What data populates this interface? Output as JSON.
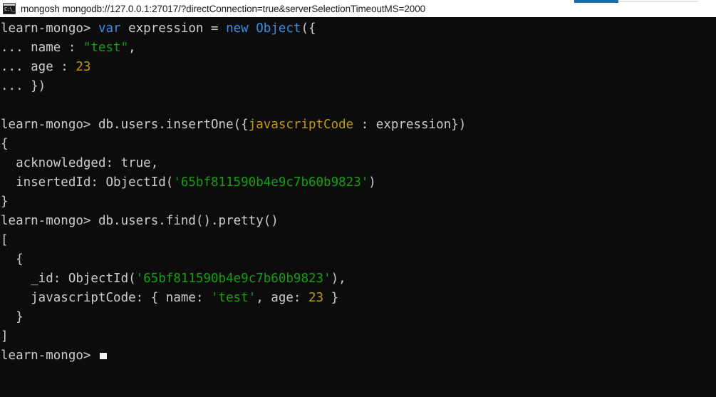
{
  "window": {
    "title": "mongosh mongodb://127.0.0.1:27017/?directConnection=true&serverSelectionTimeoutMS=2000",
    "icon": "console-cmd-icon",
    "icon_glyph": "C:\\_",
    "accent_color": "#1a6fa8",
    "titlebar_bg": "#ffffff",
    "titlebar_text_color": "#1b1b1b"
  },
  "terminal": {
    "background": "#0c0c0c",
    "foreground": "#cccccc",
    "prompt": "learn-mongo>",
    "continuation_prompt": "...",
    "colors": {
      "keyword": "#3b8eea",
      "string": "#13a10e",
      "number": "#c19c00",
      "boolean": "#c19c00",
      "field": "#c19c00",
      "default": "#cccccc"
    },
    "cursor": {
      "shape": "underscore-block",
      "color": "#f2f2f2"
    },
    "lines": [
      {
        "id": "line-1",
        "tokens": [
          {
            "t": "learn-mongo> ",
            "c": "default"
          },
          {
            "t": "var",
            "c": "keyword"
          },
          {
            "t": " expression = ",
            "c": "default"
          },
          {
            "t": "new",
            "c": "keyword"
          },
          {
            "t": " ",
            "c": "default"
          },
          {
            "t": "Object",
            "c": "keyword"
          },
          {
            "t": "({",
            "c": "default"
          }
        ]
      },
      {
        "id": "line-2",
        "tokens": [
          {
            "t": "... name : ",
            "c": "default"
          },
          {
            "t": "\"test\"",
            "c": "string"
          },
          {
            "t": ",",
            "c": "default"
          }
        ]
      },
      {
        "id": "line-3",
        "tokens": [
          {
            "t": "... age : ",
            "c": "default"
          },
          {
            "t": "23",
            "c": "number"
          }
        ]
      },
      {
        "id": "line-4",
        "tokens": [
          {
            "t": "... })",
            "c": "default"
          }
        ]
      },
      {
        "id": "line-5",
        "tokens": [
          {
            "t": "",
            "c": "default"
          }
        ]
      },
      {
        "id": "line-6",
        "tokens": [
          {
            "t": "learn-mongo> db.users.insertOne({",
            "c": "default"
          },
          {
            "t": "javascriptCode",
            "c": "field"
          },
          {
            "t": " : expression})",
            "c": "default"
          }
        ]
      },
      {
        "id": "line-7",
        "tokens": [
          {
            "t": "{",
            "c": "default"
          }
        ]
      },
      {
        "id": "line-8",
        "tokens": [
          {
            "t": "  acknowledged: ",
            "c": "default"
          },
          {
            "t": "true",
            "c": "boolean"
          },
          {
            "t": ",",
            "c": "default"
          }
        ]
      },
      {
        "id": "line-9",
        "tokens": [
          {
            "t": "  insertedId: ObjectId(",
            "c": "default"
          },
          {
            "t": "'65bf811590b4e9c7b60b9823'",
            "c": "string"
          },
          {
            "t": ")",
            "c": "default"
          }
        ]
      },
      {
        "id": "line-10",
        "tokens": [
          {
            "t": "}",
            "c": "default"
          }
        ]
      },
      {
        "id": "line-11",
        "tokens": [
          {
            "t": "learn-mongo> db.users.find().pretty()",
            "c": "default"
          }
        ]
      },
      {
        "id": "line-12",
        "tokens": [
          {
            "t": "[",
            "c": "default"
          }
        ]
      },
      {
        "id": "line-13",
        "tokens": [
          {
            "t": "  {",
            "c": "default"
          }
        ]
      },
      {
        "id": "line-14",
        "tokens": [
          {
            "t": "    _id: ObjectId(",
            "c": "default"
          },
          {
            "t": "'65bf811590b4e9c7b60b9823'",
            "c": "string"
          },
          {
            "t": "),",
            "c": "default"
          }
        ]
      },
      {
        "id": "line-15",
        "tokens": [
          {
            "t": "    javascriptCode: { name: ",
            "c": "default"
          },
          {
            "t": "'test'",
            "c": "string"
          },
          {
            "t": ", age: ",
            "c": "default"
          },
          {
            "t": "23",
            "c": "number"
          },
          {
            "t": " }",
            "c": "default"
          }
        ]
      },
      {
        "id": "line-16",
        "tokens": [
          {
            "t": "  }",
            "c": "default"
          }
        ]
      },
      {
        "id": "line-17",
        "tokens": [
          {
            "t": "]",
            "c": "default"
          }
        ]
      },
      {
        "id": "line-18",
        "tokens": [
          {
            "t": "learn-mongo> ",
            "c": "default"
          }
        ],
        "cursor": true
      }
    ]
  }
}
